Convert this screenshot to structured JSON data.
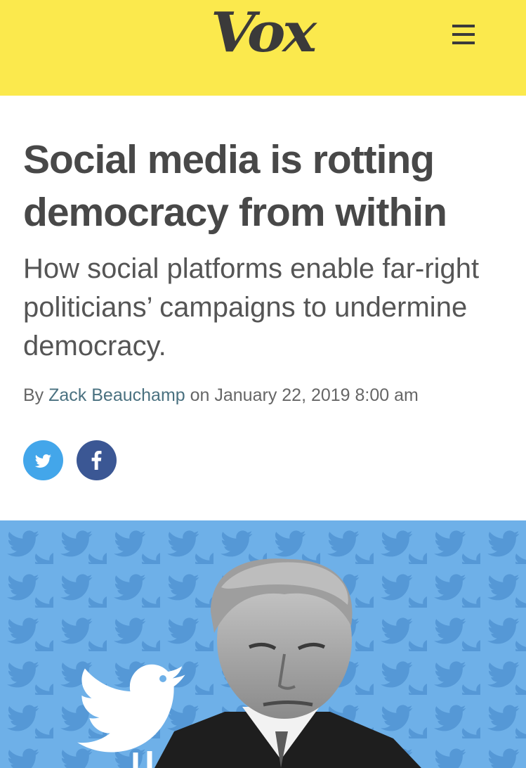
{
  "header": {
    "logo_text": "Vox",
    "menu_icon": "hamburger-menu-icon",
    "background_color": "#fbe94d"
  },
  "article": {
    "headline": "Social media is rotting democracy from within",
    "dek": "How social platforms enable far-right politicians’ campaigns to undermine democracy.",
    "byline": {
      "prefix": "By ",
      "author": "Zack Beauchamp",
      "middle": " on ",
      "date": "January 22, 2019 8:00 am"
    }
  },
  "share": [
    {
      "network": "twitter",
      "icon": "twitter-bird-icon",
      "color": "#43a6ea"
    },
    {
      "network": "facebook",
      "icon": "facebook-f-icon",
      "color": "#3b5794"
    }
  ],
  "hero_image": {
    "background_color": "#6eb0e8",
    "elements": [
      "twitter-bird-pattern",
      "white-twitter-bird",
      "grayscale-portrait"
    ]
  }
}
